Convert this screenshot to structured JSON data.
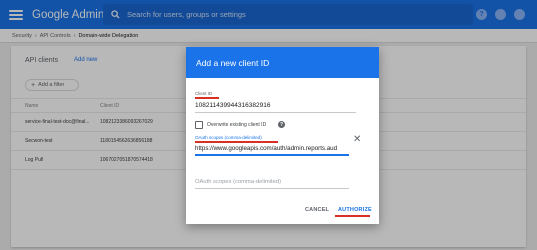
{
  "topbar": {
    "brand": "Google Admin",
    "search_placeholder": "Search for users, groups or settings",
    "help_label": "?",
    "notifications_label": "",
    "account_label": ""
  },
  "breadcrumb": [
    "Security",
    "API Controls",
    "Domain-wide Delegation"
  ],
  "page": {
    "card_title": "API clients",
    "add_new": "Add new",
    "filter_label": "Add a filter",
    "columns": [
      "Name",
      "Client ID"
    ],
    "rows": [
      {
        "name": "service-final-test-doc@final...",
        "client_id": "1082123386093267029"
      },
      {
        "name": "Secwon-test",
        "client_id": "1180154562636856188"
      },
      {
        "name": "Log Pull",
        "client_id": "1067027051870574418"
      }
    ]
  },
  "dialog": {
    "title": "Add a new client ID",
    "client_id_label": "Client ID",
    "client_id_value": "108211439944316382916",
    "overwrite_label": "Overwrite existing client ID",
    "scopes_label": "OAuth scopes (comma-delimited)",
    "scopes_value": "https://www.googleapis.com/auth/admin.reports.aud",
    "scopes_placeholder": "OAuth scopes (comma-delimited)",
    "cancel": "CANCEL",
    "authorize": "AUTHORIZE"
  },
  "colors": {
    "accent": "#1a73e8",
    "annotation": "#d93025"
  }
}
